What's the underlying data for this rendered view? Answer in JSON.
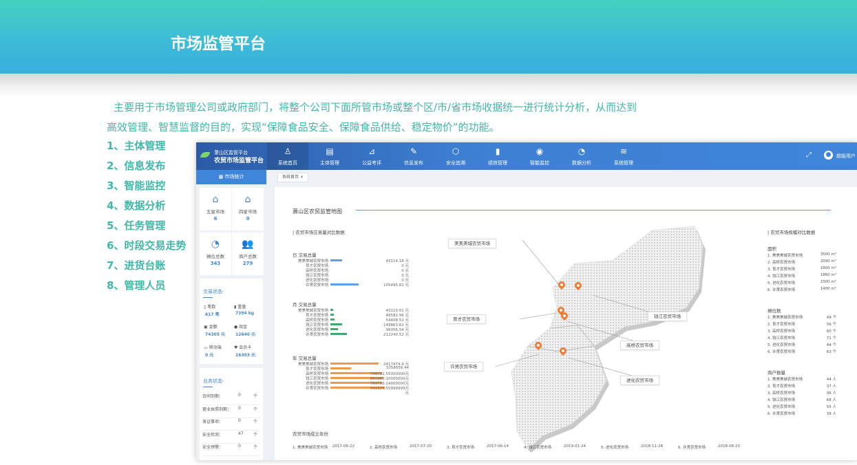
{
  "hero": {
    "title": "市场监管平台"
  },
  "description": {
    "line1": "主要用于市场管理公司或政府部门，将整个公司下面所管市场或整个区/市/省市场收据统一进行统计分析，从而达到",
    "line2": "高效管理、智慧监督的目的，实现“保障食品安全、保障食品供给、稳定物价”的功能。"
  },
  "features": [
    "1、主体管理",
    "2、信息发布",
    "3、智能监控",
    "4、数据分析",
    "5、任务管理",
    "6、时段交易走势",
    "7、进货台账",
    "8、管理人员"
  ],
  "app": {
    "logo": {
      "line1": "萧山区监管平台",
      "line2": "农贸市场监管平台"
    },
    "nav": [
      {
        "icon": "user-icon",
        "glyph": "♙",
        "label": "系统首页"
      },
      {
        "icon": "id-card-icon",
        "glyph": "▤",
        "label": "主体管理"
      },
      {
        "icon": "chart-icon",
        "glyph": "⊿",
        "label": "公益考评"
      },
      {
        "icon": "edit-icon",
        "glyph": "✎",
        "label": "信息发布"
      },
      {
        "icon": "shield-icon",
        "glyph": "⬡",
        "label": "安全追溯"
      },
      {
        "icon": "bar-chart-icon",
        "glyph": "▮",
        "label": "绩效管理"
      },
      {
        "icon": "camera-icon",
        "glyph": "◉",
        "label": "智能监控"
      },
      {
        "icon": "pie-icon",
        "glyph": "◔",
        "label": "数据分析"
      },
      {
        "icon": "layers-icon",
        "glyph": "≋",
        "label": "系统管理"
      }
    ],
    "user": "超级用户",
    "sidebar": {
      "header": "市场统计",
      "cards": [
        {
          "label": "五星市场",
          "value": "6",
          "icon": "market-icon"
        },
        {
          "label": "四星市场",
          "value": "0",
          "icon": "market-icon"
        },
        {
          "label": "摊位总数",
          "value": "343",
          "icon": "pie-icon"
        },
        {
          "label": "商户总数",
          "value": "279",
          "icon": "users-icon"
        }
      ],
      "trade": {
        "title": "交易状态-",
        "items": [
          {
            "label": "笔数",
            "value": "617 笔"
          },
          {
            "label": "重量",
            "value": "7394 kg"
          },
          {
            "label": "金额",
            "value": "74305 元"
          },
          {
            "label": "现金",
            "value": "12640 元"
          },
          {
            "label": "移动端",
            "value": "0 元"
          },
          {
            "label": "会员卡",
            "value": "16303 元"
          }
        ]
      },
      "business": {
        "title": "业务状态-",
        "items": [
          {
            "label": "合同到期：",
            "value": "0",
            "unit": "个"
          },
          {
            "label": "营业执照到期：",
            "value": "0",
            "unit": "个"
          },
          {
            "label": "发证事项：",
            "value": "0",
            "unit": "个"
          },
          {
            "label": "安全检测：",
            "value": "47",
            "unit": "个"
          },
          {
            "label": "安全预警：",
            "value": "0",
            "unit": "个"
          }
        ]
      }
    },
    "tab": "系统首页 ×",
    "main": {
      "title": "萧山区农贸监管地图",
      "compare_title": "| 农贸市场交易量对比数据",
      "day": {
        "title": "日 交易总量",
        "rows": [
          {
            "name": "美美美城农贸市场",
            "value": "43114.18 元",
            "w": 0.19
          },
          {
            "name": "育才农贸市场",
            "value": "0 元",
            "w": 0
          },
          {
            "name": "高桥农贸市场",
            "value": "0 元",
            "w": 0
          },
          {
            "name": "钱江农贸市场",
            "value": "0 元",
            "w": 0
          },
          {
            "name": "进化农贸市场",
            "value": "0 元",
            "w": 0
          },
          {
            "name": "许贤农贸市场",
            "value": "105495.82 元",
            "w": 0.47
          }
        ]
      },
      "month": {
        "title": "月 交易总量",
        "rows": [
          {
            "name": "美美美城农贸市场",
            "value": "43119.01 元",
            "w": 0.05
          },
          {
            "name": "育才农贸市场",
            "value": "48582.96 元",
            "w": 0.06
          },
          {
            "name": "高桥农贸市场",
            "value": "54408.52 元",
            "w": 0.07
          },
          {
            "name": "钱江农贸市场",
            "value": "149863.62 元",
            "w": 0.19
          },
          {
            "name": "进化农贸市场",
            "value": "96006.54 元",
            "w": 0.12
          },
          {
            "name": "许贤农贸市场",
            "value": "212240.52 元",
            "w": 0.27
          }
        ]
      },
      "year": {
        "title": "年 交易总量",
        "rows": [
          {
            "name": "美美美城农贸市场",
            "value": "2417474.4 元",
            "w": 0.79
          },
          {
            "name": "育才农贸市场",
            "value": "1058656.44",
            "w": 0.34
          },
          {
            "name": "高桥农贸市场",
            "value": "768282.55000000元",
            "w": 0.85
          },
          {
            "name": "钱江农贸市场",
            "value": "885880.10000000元",
            "w": 0.88
          },
          {
            "name": "进化农贸市场",
            "value": "769706.24000000元",
            "w": 0.85
          },
          {
            "name": "许贤农贸市场",
            "value": "991826.55999999元",
            "w": 0.9
          }
        ],
        "extra": "元"
      },
      "map_labels": [
        "美美美城农贸市场",
        "育才农贸市场",
        "许贤农贸市场",
        "钱江农贸市场",
        "高桥农贸市场",
        "进化农贸市场"
      ],
      "right_title": "| 农贸市场规模对比数据",
      "area": {
        "title": "面积",
        "rows": [
          {
            "n": "1. 美美美城农贸市场",
            "v": "3500 m²"
          },
          {
            "n": "2. 高桥农贸市场",
            "v": "2090 m²"
          },
          {
            "n": "3. 育才农贸市场",
            "v": "1800 m²"
          },
          {
            "n": "4. 钱江农贸市场",
            "v": "1860 m²"
          },
          {
            "n": "5. 进化农贸市场",
            "v": "2300 m²"
          },
          {
            "n": "6. 许贤农贸市场",
            "v": "1400 m²"
          }
        ]
      },
      "stalls": {
        "title": "摊位数",
        "rows": [
          {
            "n": "1. 美美美城农贸市场",
            "v": "49 个"
          },
          {
            "n": "2. 育才农贸市场",
            "v": "56 个"
          },
          {
            "n": "3. 高桥农贸市场",
            "v": "60 个"
          },
          {
            "n": "4. 钱江农贸市场",
            "v": "71 个"
          },
          {
            "n": "5. 进化农贸市场",
            "v": "44 个"
          },
          {
            "n": "6. 许贤农贸市场",
            "v": "63 个"
          }
        ]
      },
      "merchants": {
        "title": "商户数量",
        "rows": [
          {
            "n": "1. 美美美城农贸市场",
            "v": "44 人"
          },
          {
            "n": "2. 育才农贸市场",
            "v": "37 人"
          },
          {
            "n": "3. 高桥农贸市场",
            "v": "36 人"
          },
          {
            "n": "4. 钱江农贸市场",
            "v": "68 人"
          },
          {
            "n": "5. 进化农贸市场",
            "v": "55 人"
          },
          {
            "n": "6. 许贤农贸市场",
            "v": "39 人"
          }
        ]
      },
      "years": {
        "title": "农贸市场成立年份",
        "items": [
          {
            "n": "1. 美美美城农贸市场",
            "d": "2017-06-22"
          },
          {
            "n": "2. 高桥农贸市场",
            "d": "2017-07-20"
          },
          {
            "n": "3. 育才农贸市场",
            "d": "2017-06-14"
          },
          {
            "n": "4. 钱江农贸市场",
            "d": "2019-01-24"
          },
          {
            "n": "5. 进化农贸市场",
            "d": "2018-11-28"
          },
          {
            "n": "6. 许贤农贸市场",
            "d": "2018-08-23"
          }
        ]
      }
    }
  }
}
